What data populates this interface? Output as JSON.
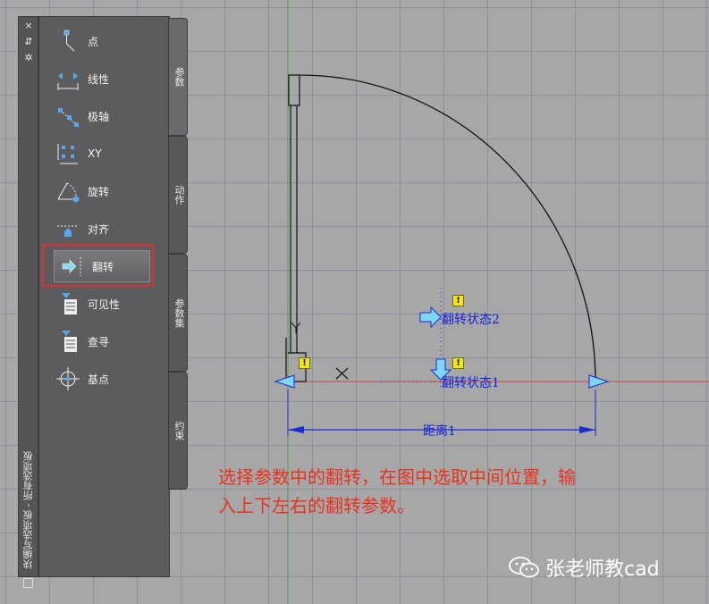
{
  "palette": {
    "title": "块编写选项板 - 所有选项板",
    "controls": [
      "×",
      "⇵",
      "✲"
    ],
    "tabs": [
      {
        "label": "参数",
        "active": true
      },
      {
        "label": "动作",
        "active": false
      },
      {
        "label": "参数集",
        "active": false
      },
      {
        "label": "约束",
        "active": false
      }
    ],
    "tools": [
      {
        "label": "点",
        "icon": "point-param-icon"
      },
      {
        "label": "线性",
        "icon": "linear-param-icon"
      },
      {
        "label": "极轴",
        "icon": "polar-param-icon"
      },
      {
        "label": "XY",
        "icon": "xy-param-icon"
      },
      {
        "label": "旋转",
        "icon": "rotation-param-icon"
      },
      {
        "label": "对齐",
        "icon": "alignment-param-icon"
      },
      {
        "label": "翻转",
        "icon": "flip-param-icon",
        "selected": true
      },
      {
        "label": "可见性",
        "icon": "visibility-param-icon"
      },
      {
        "label": "查寻",
        "icon": "lookup-param-icon"
      },
      {
        "label": "基点",
        "icon": "basepoint-param-icon"
      }
    ]
  },
  "drawing": {
    "labels": {
      "flip_state_2": "翻转状态2",
      "flip_state_1": "翻转状态1",
      "distance": "距离1"
    },
    "warning_mark": "!",
    "colors": {
      "param_blue": "#1424d8",
      "flip_arrow": "#7fd6f2",
      "warning": "#f4e61a",
      "axis_red": "#c84a4a"
    }
  },
  "annotation": {
    "line1": "选择参数中的翻转，在图中选取中间位置，输",
    "line2": "入上下左右的翻转参数。"
  },
  "watermark": {
    "text": "张老师教cad",
    "icon": "wechat-icon"
  }
}
